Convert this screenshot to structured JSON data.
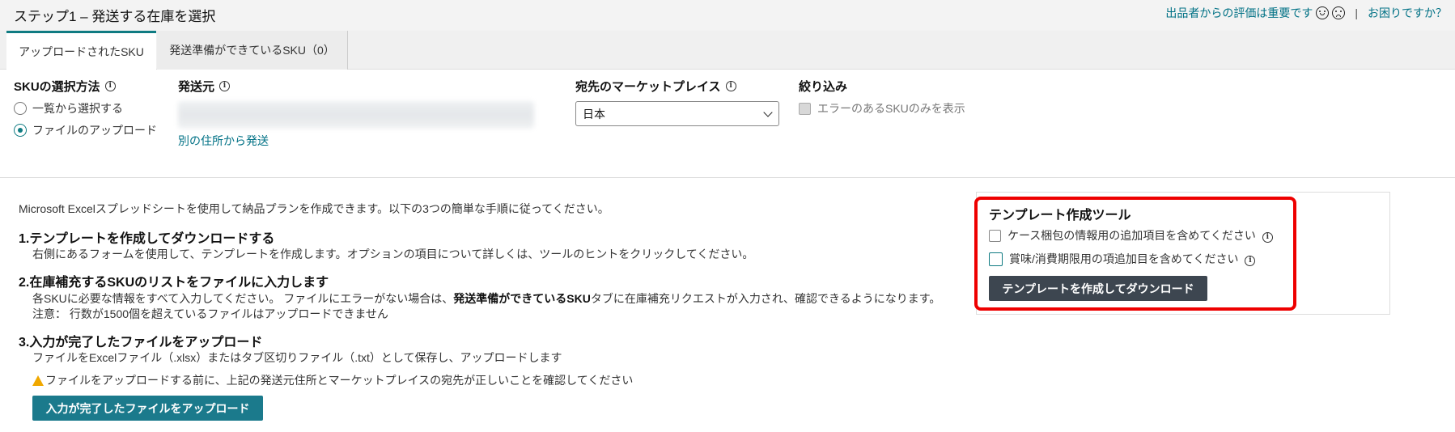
{
  "header": {
    "title": "ステップ1 – 発送する在庫を選択",
    "feedback_text": "出品者からの評価は重要です",
    "separator": "|",
    "help_link": "お困りですか？"
  },
  "tabs": [
    {
      "label": "アップロードされたSKU",
      "active": true
    },
    {
      "label": "発送準備ができているSKU（0）",
      "active": false
    }
  ],
  "sku_method": {
    "label": "SKUの選択方法",
    "options": [
      {
        "label": "一覧から選択する",
        "checked": false
      },
      {
        "label": "ファイルのアップロード",
        "checked": true
      }
    ]
  },
  "ship_from": {
    "label": "発送元",
    "alt_link": "別の住所から発送"
  },
  "marketplace": {
    "label": "宛先のマーケットプレイス",
    "selected": "日本"
  },
  "filter": {
    "label": "絞り込み",
    "checkbox_label": "エラーのあるSKUのみを表示"
  },
  "instructions": {
    "intro": "Microsoft Excelスプレッドシートを使用して納品プランを作成できます。以下の3つの簡単な手順に従ってください。",
    "step1": {
      "heading": "1.テンプレートを作成してダウンロードする",
      "text": "右側にあるフォームを使用して、テンプレートを作成します。オプションの項目について詳しくは、ツールのヒントをクリックしてください。"
    },
    "step2": {
      "heading": "2.在庫補充するSKUのリストをファイルに入力します",
      "text_before": "各SKUに必要な情報をすべて入力してください。 ファイルにエラーがない場合は、",
      "text_bold": "発送準備ができているSKU",
      "text_after": "タブに在庫補充リクエストが入力され、確認できるようになります。",
      "note": "注意： 行数が1500個を超えているファイルはアップロードできません"
    },
    "step3": {
      "heading": "3.入力が完了したファイルをアップロード",
      "text": "ファイルをExcelファイル（.xlsx）またはタブ区切りファイル（.txt）として保存し、アップロードします"
    },
    "warning": "ファイルをアップロードする前に、上記の発送元住所とマーケットプレイスの宛先が正しいことを確認してください",
    "upload_button": "入力が完了したファイルをアップロード"
  },
  "template_tool": {
    "title": "テンプレート作成ツール",
    "option1": "ケース梱包の情報用の追加項目を含めてください",
    "option2": "賞味/消費期限用の項追加目を含めてください",
    "button": "テンプレートを作成してダウンロード"
  },
  "colors": {
    "teal": "#0f7b82",
    "link": "#007185",
    "upload_button": "#1b7a8c",
    "dark_button": "#3d4650",
    "highlight": "#e00000",
    "warning": "#f0a800"
  }
}
